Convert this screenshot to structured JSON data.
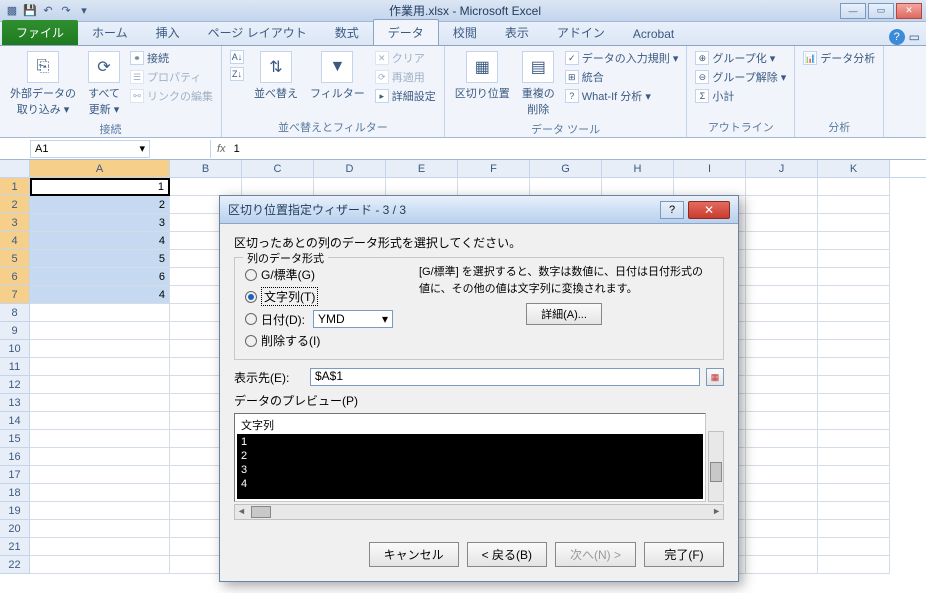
{
  "app": {
    "title": "作業用.xlsx - Microsoft Excel"
  },
  "qat": {
    "save": "💾",
    "undo": "↶",
    "redo": "↷"
  },
  "tabs": {
    "file": "ファイル",
    "home": "ホーム",
    "insert": "挿入",
    "pageLayout": "ページ レイアウト",
    "formulas": "数式",
    "data": "データ",
    "review": "校閲",
    "view": "表示",
    "addin": "アドイン",
    "acrobat": "Acrobat"
  },
  "ribbon": {
    "externalData": {
      "label": "外部データの\n取り込み ▾",
      "refresh": "すべて\n更新 ▾",
      "connect": "接続",
      "properties": "プロパティ",
      "editLinks": "リンクの編集",
      "group": "接続"
    },
    "sort": {
      "az": "A↓Z",
      "za": "Z↓A",
      "sortBtn": "並べ替え",
      "filter": "フィルター",
      "clear": "クリア",
      "reapply": "再適用",
      "advanced": "詳細設定",
      "group": "並べ替えとフィルター"
    },
    "dataTools": {
      "textToCol": "区切り位置",
      "removeDup": "重複の\n削除",
      "validation": "データの入力規則 ▾",
      "consolidate": "統合",
      "whatif": "What-If 分析 ▾",
      "group": "データ ツール"
    },
    "outline": {
      "groupBtn": "グループ化 ▾",
      "ungroup": "グループ解除 ▾",
      "subtotal": "小計",
      "group": "アウトライン"
    },
    "analysis": {
      "dataAnalysis": "データ分析",
      "group": "分析"
    }
  },
  "formula": {
    "namebox": "A1",
    "fx": "fx",
    "value": "1"
  },
  "columns": [
    "A",
    "B",
    "C",
    "D",
    "E",
    "F",
    "G",
    "H",
    "I",
    "J",
    "K"
  ],
  "rows": [
    "1",
    "2",
    "3",
    "4",
    "5",
    "6",
    "7",
    "8",
    "9",
    "10",
    "11",
    "12",
    "13",
    "14",
    "15",
    "16",
    "17",
    "18",
    "19",
    "20",
    "21",
    "22"
  ],
  "cells": {
    "a1": "1",
    "a2": "2",
    "a3": "3",
    "a4": "4",
    "a5": "5",
    "a6": "6",
    "a7": "4"
  },
  "dialog": {
    "title": "区切り位置指定ウィザード - 3 / 3",
    "instruction": "区切ったあとの列のデータ形式を選択してください。",
    "fieldset": "列のデータ形式",
    "radioGeneral": "G/標準(G)",
    "radioText": "文字列(T)",
    "radioDate": "日付(D):",
    "dateFormat": "YMD",
    "radioSkip": "削除する(I)",
    "info": "[G/標準] を選択すると、数字は数値に、日付は日付形式の値に、その他の値は文字列に変換されます。",
    "detailBtn": "詳細(A)...",
    "destLabel": "表示先(E):",
    "destValue": "$A$1",
    "previewLabel": "データのプレビュー(P)",
    "previewHead": "文字列",
    "previewRows": [
      "1",
      "2",
      "3",
      "4"
    ],
    "btnCancel": "キャンセル",
    "btnBack": "< 戻る(B)",
    "btnNext": "次へ(N) >",
    "btnFinish": "完了(F)"
  }
}
